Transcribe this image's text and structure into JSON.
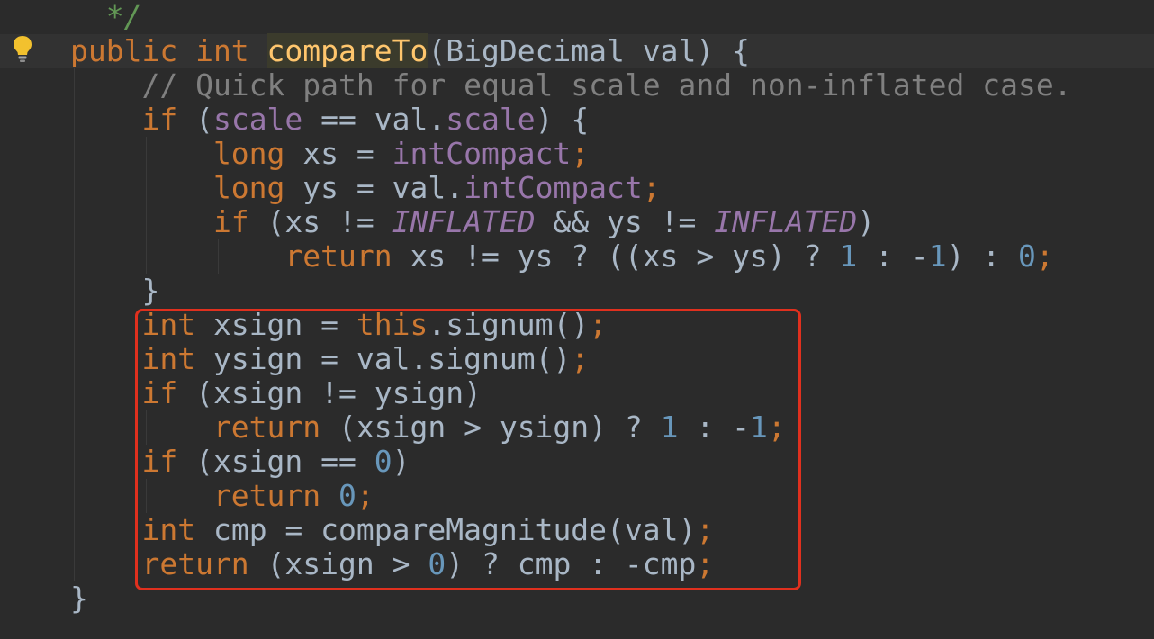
{
  "editor": {
    "lines": [
      [
        [
          "doc",
          "  */"
        ]
      ],
      [
        [
          "kw",
          "public int "
        ],
        [
          "hl",
          "compareTo"
        ],
        [
          "plain",
          "(BigDecimal val) {"
        ]
      ],
      [
        [
          "cmt",
          "    // Quick path for equal scale and non-inflated case."
        ]
      ],
      [
        [
          "kw",
          "    if "
        ],
        [
          "plain",
          "("
        ],
        [
          "fld",
          "scale"
        ],
        [
          "plain",
          " == val."
        ],
        [
          "fld",
          "scale"
        ],
        [
          "plain",
          ") {"
        ]
      ],
      [
        [
          "kw",
          "        long "
        ],
        [
          "plain",
          "xs = "
        ],
        [
          "fld",
          "intCompact"
        ],
        [
          "kw",
          ";"
        ]
      ],
      [
        [
          "kw",
          "        long "
        ],
        [
          "plain",
          "ys = val."
        ],
        [
          "fld",
          "intCompact"
        ],
        [
          "kw",
          ";"
        ]
      ],
      [
        [
          "kw",
          "        if "
        ],
        [
          "plain",
          "(xs != "
        ],
        [
          "fldi",
          "INFLATED"
        ],
        [
          "plain",
          " && ys != "
        ],
        [
          "fldi",
          "INFLATED"
        ],
        [
          "plain",
          ")"
        ]
      ],
      [
        [
          "kw",
          "            return "
        ],
        [
          "plain",
          "xs != ys ? ((xs > ys) ? "
        ],
        [
          "num",
          "1"
        ],
        [
          "plain",
          " : -"
        ],
        [
          "num",
          "1"
        ],
        [
          "plain",
          ") : "
        ],
        [
          "num",
          "0"
        ],
        [
          "kw",
          ";"
        ]
      ],
      [
        [
          "plain",
          "    }"
        ]
      ],
      [
        [
          "kw",
          "    int "
        ],
        [
          "plain",
          "xsign = "
        ],
        [
          "kw",
          "this"
        ],
        [
          "plain",
          ".signum()"
        ],
        [
          "kw",
          ";"
        ]
      ],
      [
        [
          "kw",
          "    int "
        ],
        [
          "plain",
          "ysign = val.signum()"
        ],
        [
          "kw",
          ";"
        ]
      ],
      [
        [
          "kw",
          "    if "
        ],
        [
          "plain",
          "(xsign != ysign)"
        ]
      ],
      [
        [
          "kw",
          "        return "
        ],
        [
          "plain",
          "(xsign > ysign) ? "
        ],
        [
          "num",
          "1"
        ],
        [
          "plain",
          " : -"
        ],
        [
          "num",
          "1"
        ],
        [
          "kw",
          ";"
        ]
      ],
      [
        [
          "kw",
          "    if "
        ],
        [
          "plain",
          "(xsign == "
        ],
        [
          "num",
          "0"
        ],
        [
          "plain",
          ")"
        ]
      ],
      [
        [
          "kw",
          "        return "
        ],
        [
          "num",
          "0"
        ],
        [
          "kw",
          ";"
        ]
      ],
      [
        [
          "kw",
          "    int "
        ],
        [
          "plain",
          "cmp = compareMagnitude(val)"
        ],
        [
          "kw",
          ";"
        ]
      ],
      [
        [
          "kw",
          "    return "
        ],
        [
          "plain",
          "(xsign > "
        ],
        [
          "num",
          "0"
        ],
        [
          "plain",
          ") ? cmp : -cmp"
        ],
        [
          "kw",
          ";"
        ]
      ],
      [
        [
          "plain",
          "}"
        ]
      ]
    ]
  },
  "colors": {
    "background": "#2b2b2b",
    "keyword": "#cc7832",
    "field": "#9876aa",
    "number": "#6897bb",
    "comment": "#808080",
    "doc_comment": "#629755",
    "method_highlight": "#ffc66d",
    "annotation_box": "#e0301e"
  },
  "icons": {
    "gutter": "lightbulb-icon"
  }
}
